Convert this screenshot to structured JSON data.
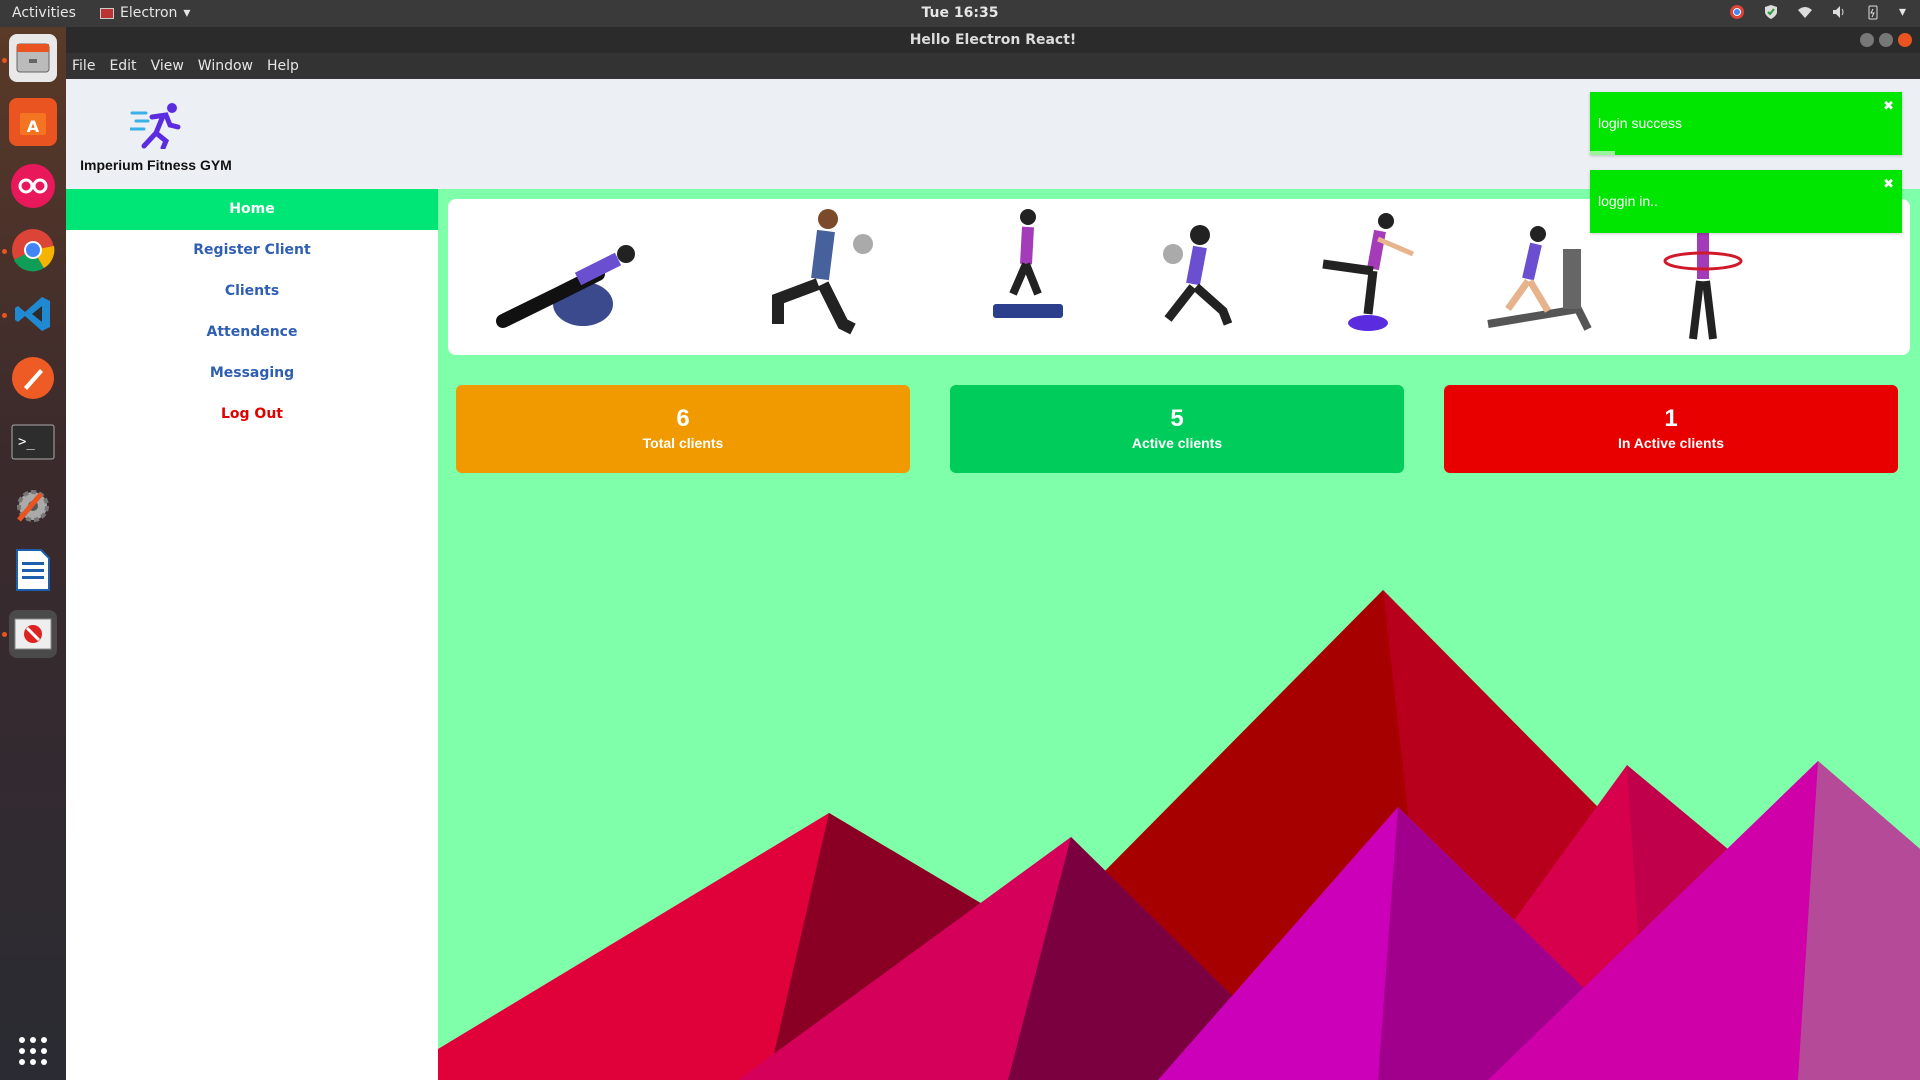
{
  "topbar": {
    "activities": "Activities",
    "app_name": "Electron",
    "clock": "Tue 16:35"
  },
  "window": {
    "title": "Hello Electron React!",
    "menu": [
      "File",
      "Edit",
      "View",
      "Window",
      "Help"
    ]
  },
  "app": {
    "brand": "Imperium Fitness GYM",
    "nav": [
      {
        "label": "Home",
        "active": true
      },
      {
        "label": "Register Client"
      },
      {
        "label": "Clients"
      },
      {
        "label": "Attendence"
      },
      {
        "label": "Messaging"
      },
      {
        "label": "Log Out"
      }
    ],
    "stats": [
      {
        "value": "6",
        "label": "Total clients",
        "color": "#f09a00"
      },
      {
        "value": "5",
        "label": "Active clients",
        "color": "#00cc5c"
      },
      {
        "value": "1",
        "label": "In Active clients",
        "color": "#e80000"
      }
    ]
  },
  "toasts": [
    {
      "message": "login success",
      "progress": 0.08
    },
    {
      "message": "loggin in..",
      "progress": 0.0
    }
  ],
  "colors": {
    "accent_green": "#00e676",
    "background": "#80ffaa",
    "toast": "#00e600"
  }
}
